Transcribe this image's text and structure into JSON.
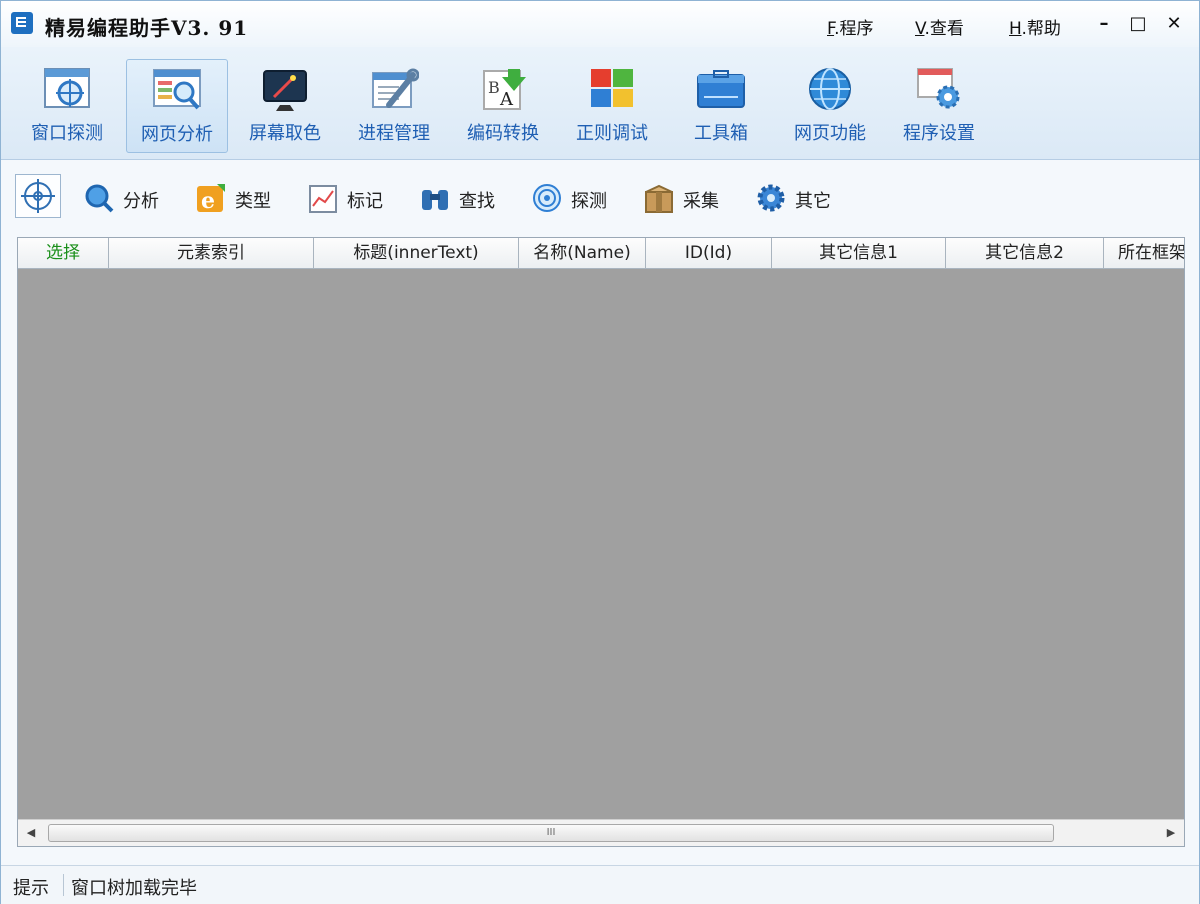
{
  "window": {
    "title": "精易编程助手V3. 91",
    "menus": [
      {
        "key": "F",
        "label": ".程序"
      },
      {
        "key": "V",
        "label": ".查看"
      },
      {
        "key": "H",
        "label": ".帮助"
      }
    ],
    "controls": {
      "minimize": "–",
      "maximize": "□",
      "close": "✕"
    }
  },
  "main_toolbar": [
    {
      "label": "窗口探测",
      "icon": "window-probe-icon",
      "active": false
    },
    {
      "label": "网页分析",
      "icon": "web-analysis-icon",
      "active": true
    },
    {
      "label": "屏幕取色",
      "icon": "screen-color-picker-icon",
      "active": false
    },
    {
      "label": "进程管理",
      "icon": "process-manager-icon",
      "active": false
    },
    {
      "label": "编码转换",
      "icon": "encoding-convert-icon",
      "active": false
    },
    {
      "label": "正则调试",
      "icon": "regex-debug-icon",
      "active": false
    },
    {
      "label": "工具箱",
      "icon": "toolbox-icon",
      "active": false
    },
    {
      "label": "网页功能",
      "icon": "web-function-icon",
      "active": false
    },
    {
      "label": "程序设置",
      "icon": "program-settings-icon",
      "active": false
    }
  ],
  "sub_toolbar": [
    {
      "label": "分析",
      "icon": "analyze-magnifier-icon"
    },
    {
      "label": "类型",
      "icon": "ie-type-icon"
    },
    {
      "label": "标记",
      "icon": "mark-chart-icon"
    },
    {
      "label": "查找",
      "icon": "binoculars-icon"
    },
    {
      "label": "探测",
      "icon": "target-icon"
    },
    {
      "label": "采集",
      "icon": "collect-box-icon"
    },
    {
      "label": "其它",
      "icon": "gear-icon"
    }
  ],
  "grid": {
    "columns": [
      "选择",
      "元素索引",
      "标题(innerText)",
      "名称(Name)",
      "ID(Id)",
      "其它信息1",
      "其它信息2",
      "所在框架"
    ],
    "rows": [],
    "scroll_thumb_label": "III"
  },
  "status": {
    "label": "提示",
    "text": "窗口树加载完毕"
  },
  "colors": {
    "toolbar_label": "#1f5fb3",
    "grid_background": "#a0a0a0",
    "select_column": "#1a8f1a"
  }
}
